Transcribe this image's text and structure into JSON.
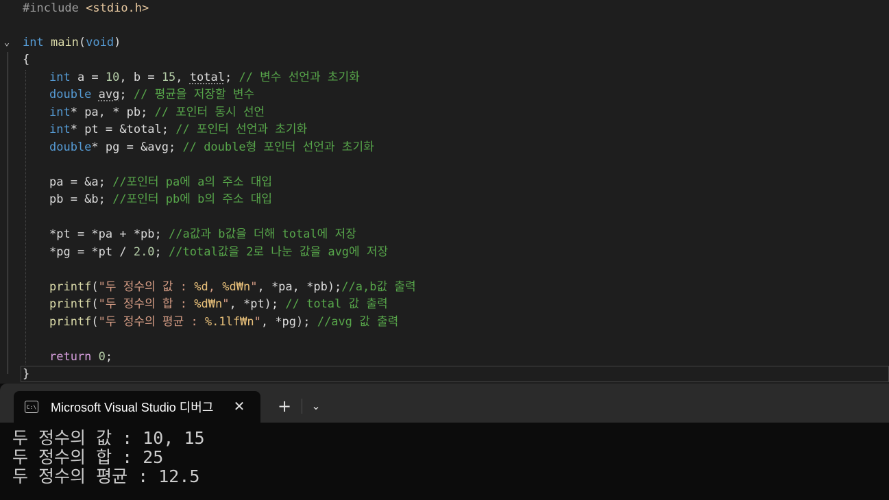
{
  "editor": {
    "fold_icon": "chevron-down-icon",
    "lines": {
      "l1": {
        "pre": "#include",
        "header": "<stdio.h>"
      },
      "l3": {
        "type": "int",
        "name": "main",
        "paren_open": "(",
        "param": "void",
        "paren_close": ")"
      },
      "l4": {
        "text": "{"
      },
      "l5": {
        "type": "int",
        "code_a": " a = ",
        "n1": "10",
        "code_b": ", b = ",
        "n2": "15",
        "code_c": ", ",
        "var": "total",
        "code_d": "; ",
        "comment": "// 변수 선언과 초기화"
      },
      "l6": {
        "type": "double",
        "code_a": " ",
        "var": "avg",
        "code_b": "; ",
        "comment": "// 평균을 저장할 변수"
      },
      "l7": {
        "type": "int",
        "code": "* pa, * pb; ",
        "comment": "// 포인터 동시 선언"
      },
      "l8": {
        "type": "int",
        "code": "* pt = &total; ",
        "comment": "// 포인터 선언과 초기화"
      },
      "l9": {
        "type": "double",
        "code": "* pg = &avg; ",
        "comment": "// double형 포인터 선언과 초기화"
      },
      "l11": {
        "code": "pa = &a; ",
        "comment": "//포인터 pa에 a의 주소 대입"
      },
      "l12": {
        "code": "pb = &b; ",
        "comment": "//포인터 pb에 b의 주소 대입"
      },
      "l14": {
        "code": "*pt = *pa + *pb; ",
        "comment": "//a값과 b값을 더해 total에 저장"
      },
      "l15": {
        "code_a": "*pg = *pt / ",
        "num": "2.0",
        "code_b": "; ",
        "comment": "//total값을 2로 나눈 값을 avg에 저장"
      },
      "l17": {
        "fn": "printf",
        "p_open": "(",
        "str_a": "\"두 정수의 값 : ",
        "f1": "%d",
        "str_b": ", ",
        "f2": "%d",
        "esc": "₩n",
        "str_c": "\"",
        "code": ", *pa, *pb);",
        "comment": "//a,b값 출력"
      },
      "l18": {
        "fn": "printf",
        "p_open": "(",
        "str_a": "\"두 정수의 합 : ",
        "f1": "%d",
        "esc": "₩n",
        "str_c": "\"",
        "code": ", *pt); ",
        "comment": "// total 값 출력"
      },
      "l19": {
        "fn": "printf",
        "p_open": "(",
        "str_a": "\"두 정수의 평균 : ",
        "f1": "%.1lf",
        "esc": "₩n",
        "str_c": "\"",
        "code": ", *pg); ",
        "comment": "//avg 값 출력"
      },
      "l21": {
        "kw": "return",
        "code_a": " ",
        "num": "0",
        "code_b": ";"
      },
      "l22": {
        "text": "}"
      }
    }
  },
  "terminal": {
    "tab_icon": "terminal-icon",
    "tab_icon_text": "C:\\",
    "tab_title": "Microsoft Visual Studio 디버그",
    "close_label": "✕",
    "new_tab_label": "+",
    "dropdown_label": "⌄",
    "output": [
      "두 정수의 값 : 10, 15",
      "두 정수의 합 : 25",
      "두 정수의 평균 : 12.5"
    ]
  }
}
